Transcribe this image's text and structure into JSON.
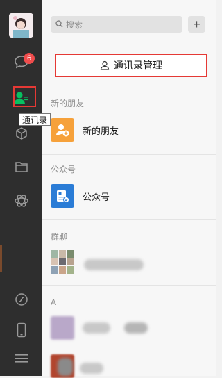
{
  "rail": {
    "unread_badge": "6",
    "tooltip": "通讯录"
  },
  "search": {
    "placeholder": "搜索",
    "add_label": "+"
  },
  "contacts": {
    "manage_button": "通讯录管理",
    "sections": {
      "new_friends_title": "新的朋友",
      "new_friends_item": "新的朋友",
      "official_title": "公众号",
      "official_item": "公众号",
      "groups_title": "群聊",
      "alpha_title": "A"
    }
  },
  "colors": {
    "rail_bg": "#2e2e2e",
    "accent_green": "#07c160",
    "new_friends_orange": "#f6a13a",
    "official_blue": "#2a7cd6",
    "highlight_red": "#e53935"
  }
}
